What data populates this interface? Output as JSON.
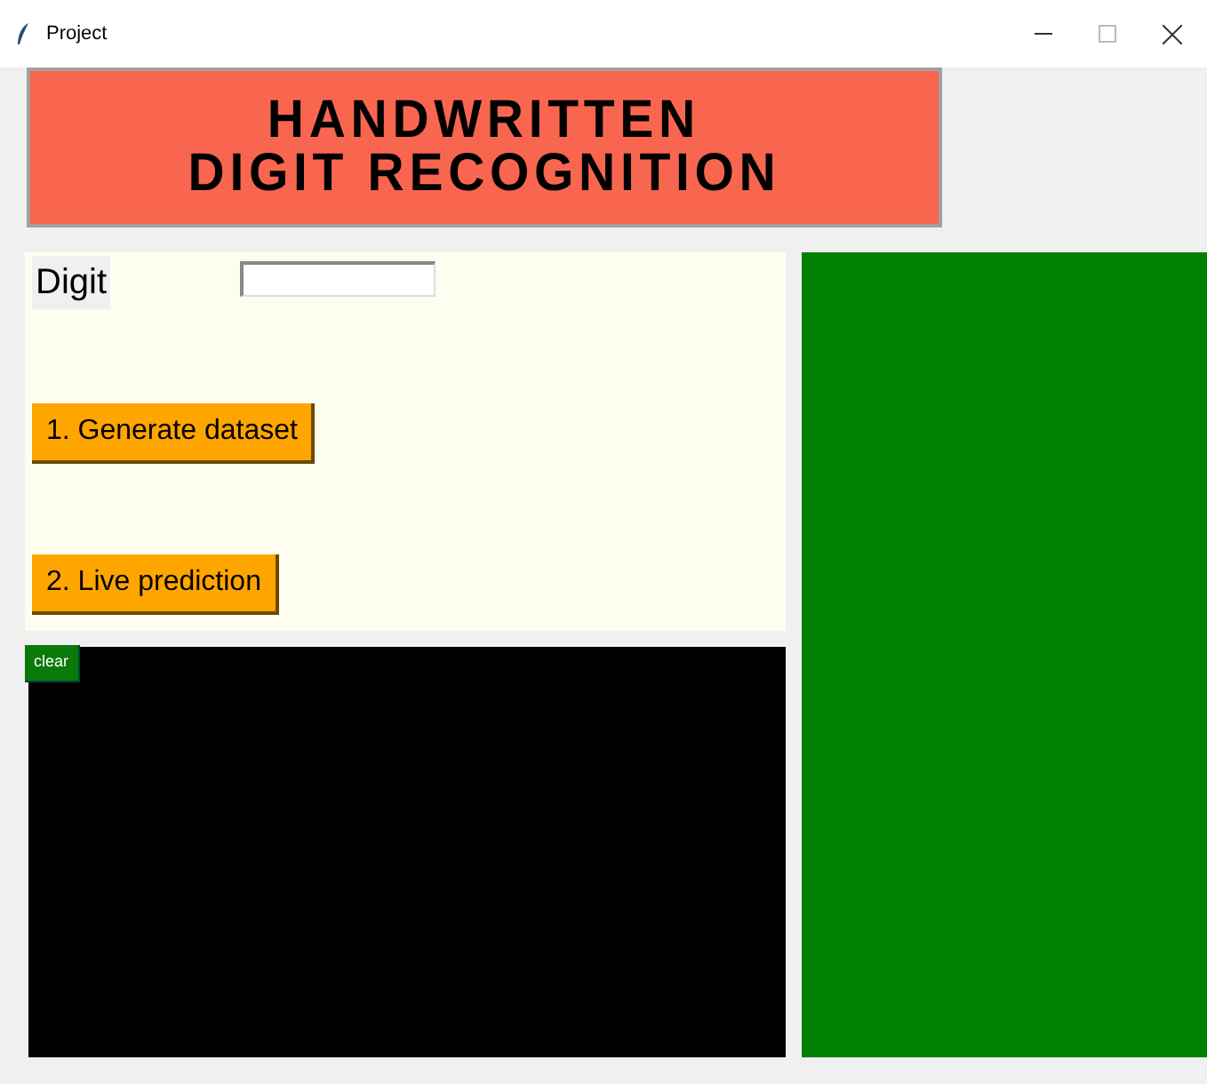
{
  "window": {
    "title": "Project"
  },
  "banner": {
    "lines": [
      "HANDWRITTEN",
      "DIGIT RECOGNITION"
    ]
  },
  "form": {
    "label": "Digit"
  },
  "buttons": [
    "1. Generate dataset",
    "2. Live prediction"
  ],
  "canvas": {
    "clear_button": "clear"
  }
}
